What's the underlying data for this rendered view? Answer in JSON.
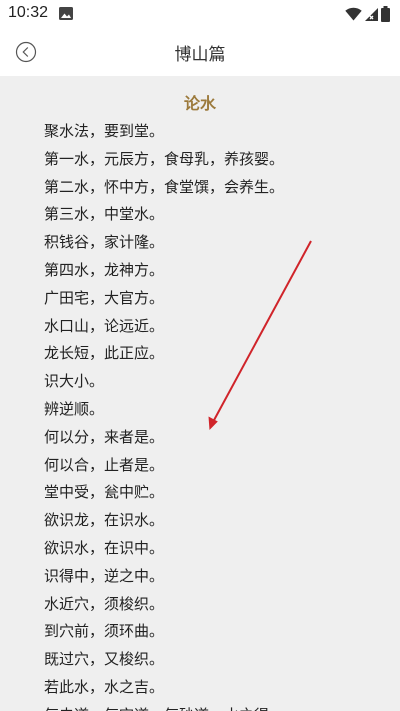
{
  "status_bar": {
    "time": "10:32"
  },
  "header": {
    "title": "博山篇"
  },
  "article": {
    "heading": "论水",
    "lines": [
      "聚水法，要到堂。",
      "第一水，元辰方，食母乳，养孩婴。",
      "第二水，怀中方，食堂馔，会养生。",
      "第三水，中堂水。",
      "积钱谷，家计隆。",
      "第四水，龙神方。",
      "广田宅，大官方。",
      "水口山，论远近。",
      "龙长短，此正应。",
      "识大小。",
      "辨逆顺。",
      "何以分，来者是。",
      "何以合，止者是。",
      "堂中受，瓮中贮。",
      "欲识龙，在识水。",
      "欲识水，在识中。",
      "识得中，逆之中。",
      "水近穴，须梭织。",
      "到穴前，须环曲。",
      "既过穴，又梭织。",
      "若此水，水之吉。",
      "气未道，气空道，气砂道，水之得。"
    ]
  },
  "colors": {
    "heading": "#9c7a3c",
    "content_background": "#efefef",
    "arrow": "#d0242a"
  },
  "icons": {
    "back": "back-circle-icon",
    "gallery": "image-icon",
    "wifi": "wifi-icon",
    "signal": "signal-icon",
    "battery": "battery-icon"
  }
}
